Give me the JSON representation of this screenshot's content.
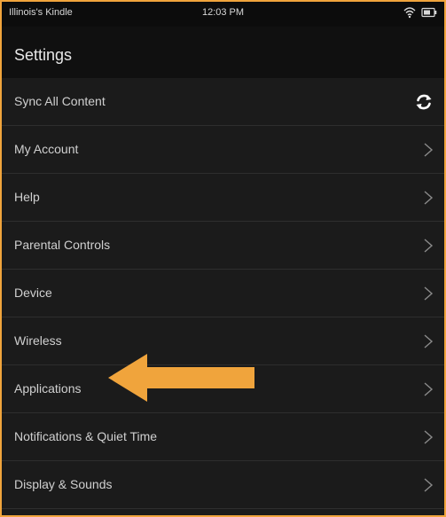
{
  "status_bar": {
    "device_name": "Illinois's Kindle",
    "time": "12:03 PM",
    "icons": [
      "wifi-icon",
      "battery-icon"
    ]
  },
  "header": {
    "title": "Settings"
  },
  "settings_items": [
    {
      "label": "Sync All Content",
      "icon": "sync-icon"
    },
    {
      "label": "My Account",
      "icon": "chevron-right-icon"
    },
    {
      "label": "Help",
      "icon": "chevron-right-icon"
    },
    {
      "label": "Parental Controls",
      "icon": "chevron-right-icon"
    },
    {
      "label": "Device",
      "icon": "chevron-right-icon"
    },
    {
      "label": "Wireless",
      "icon": "chevron-right-icon"
    },
    {
      "label": "Applications",
      "icon": "chevron-right-icon"
    },
    {
      "label": "Notifications & Quiet Time",
      "icon": "chevron-right-icon"
    },
    {
      "label": "Display & Sounds",
      "icon": "chevron-right-icon"
    }
  ],
  "annotation": {
    "icon": "arrow-left-icon",
    "color": "#f0a43c"
  },
  "colors": {
    "frame_border": "#f0a43c",
    "background": "#1b1b1b",
    "header_background": "#101010",
    "status_background": "#0c0c0c",
    "text": "#d0d0d0"
  }
}
